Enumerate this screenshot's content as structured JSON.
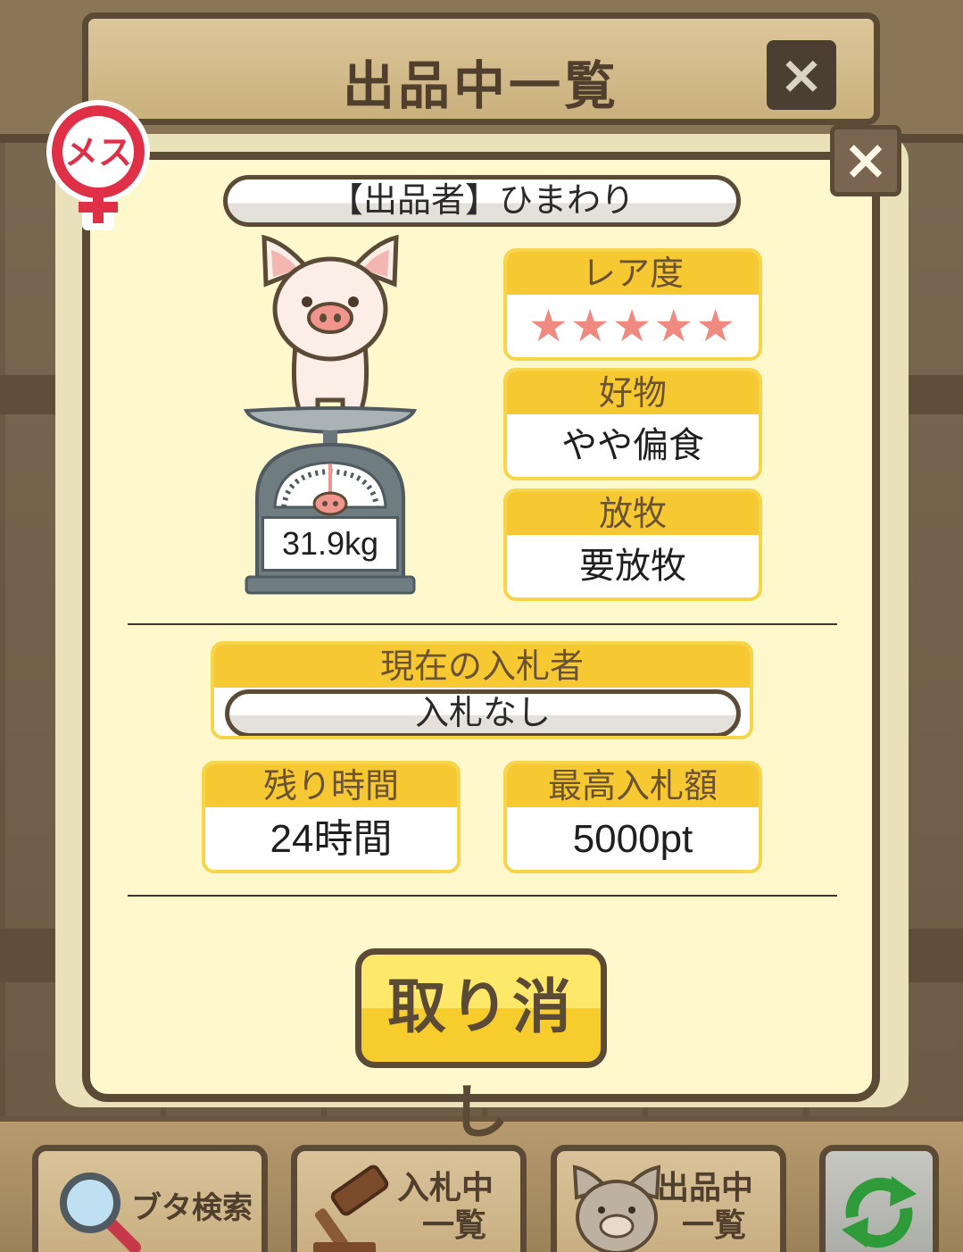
{
  "header": {
    "title": "出品中一覧",
    "close_icon": "×"
  },
  "panel": {
    "close_icon": "×",
    "gender_badge": "メス",
    "seller": "【出品者】ひまわり",
    "weight": "31.9kg",
    "rarity": {
      "label": "レア度",
      "stars": "★★★★★",
      "value": 5,
      "max": 5
    },
    "favorite_food": {
      "label": "好物",
      "value": "やや偏食"
    },
    "grazing": {
      "label": "放牧",
      "value": "要放牧"
    },
    "current_bidder": {
      "label": "現在の入札者",
      "value": "入札なし"
    },
    "time_left": {
      "label": "残り時間",
      "value": "24時間"
    },
    "highest_bid": {
      "label": "最高入札額",
      "value": "5000pt"
    },
    "cancel_label": "取り消し"
  },
  "tabs": {
    "search": {
      "label": "ブタ検索",
      "icon": "magnifier-icon"
    },
    "bids": {
      "label_line1": "入札中",
      "label_line2": "一覧",
      "icon": "gavel-icon"
    },
    "listing": {
      "label_line1": "出品中",
      "label_line2": "一覧",
      "icon": "pig-face-icon"
    },
    "refresh": {
      "icon": "refresh-icon"
    }
  },
  "colors": {
    "panel_bg": "#fff8cc",
    "card_header": "#f6c932",
    "border_brown": "#5b4a35",
    "star_pink": "#f08a80",
    "badge_red": "#e03048"
  }
}
